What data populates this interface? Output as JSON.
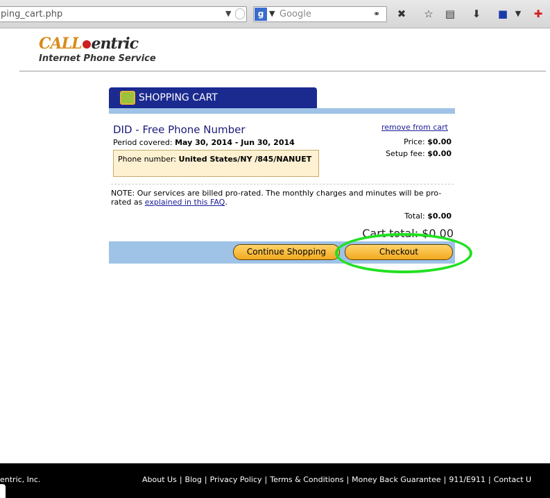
{
  "browser": {
    "url": "ping_cart.php",
    "search_engine_icon": "g",
    "search_placeholder": "Google",
    "icons": [
      "rss-off-icon",
      "star-icon",
      "clipboard-icon",
      "download-icon",
      "save-icon",
      "chevron-down-icon",
      "addon-icon"
    ]
  },
  "header": {
    "logo_call": "CALL",
    "logo_centric": "entric",
    "tagline": "Internet Phone Service"
  },
  "cart": {
    "title": "SHOPPING CART",
    "item": {
      "name": "DID - Free Phone Number",
      "period_label": "Period covered:",
      "period_value": "May 30, 2014 - Jun 30, 2014",
      "phone_label": "Phone number:",
      "phone_value": "United States/NY /845/NANUET",
      "remove_label": "remove from cart",
      "price_label": "Price:",
      "price_value": "$0.00",
      "setup_label": "Setup fee:",
      "setup_value": "$0.00"
    },
    "note_text": "NOTE: Our services are billed pro-rated. The monthly charges and minutes will be pro-rated as ",
    "note_link": "explained in this FAQ",
    "note_end": ".",
    "total_label": "Total:",
    "total_value": "$0.00",
    "cart_total": "Cart total: $0.00",
    "continue_label": "Continue Shopping",
    "checkout_label": "Checkout"
  },
  "footer": {
    "copyright": "entric, Inc.",
    "links": [
      "About Us",
      "Blog",
      "Privacy Policy",
      "Terms & Conditions",
      "Money Back Guarantee",
      "911/E911",
      "Contact U"
    ]
  },
  "colors": {
    "cart_tab": "#1a2a8f",
    "band": "#9fc3e6",
    "button": "#f2a91f",
    "highlight": "#22e022"
  }
}
